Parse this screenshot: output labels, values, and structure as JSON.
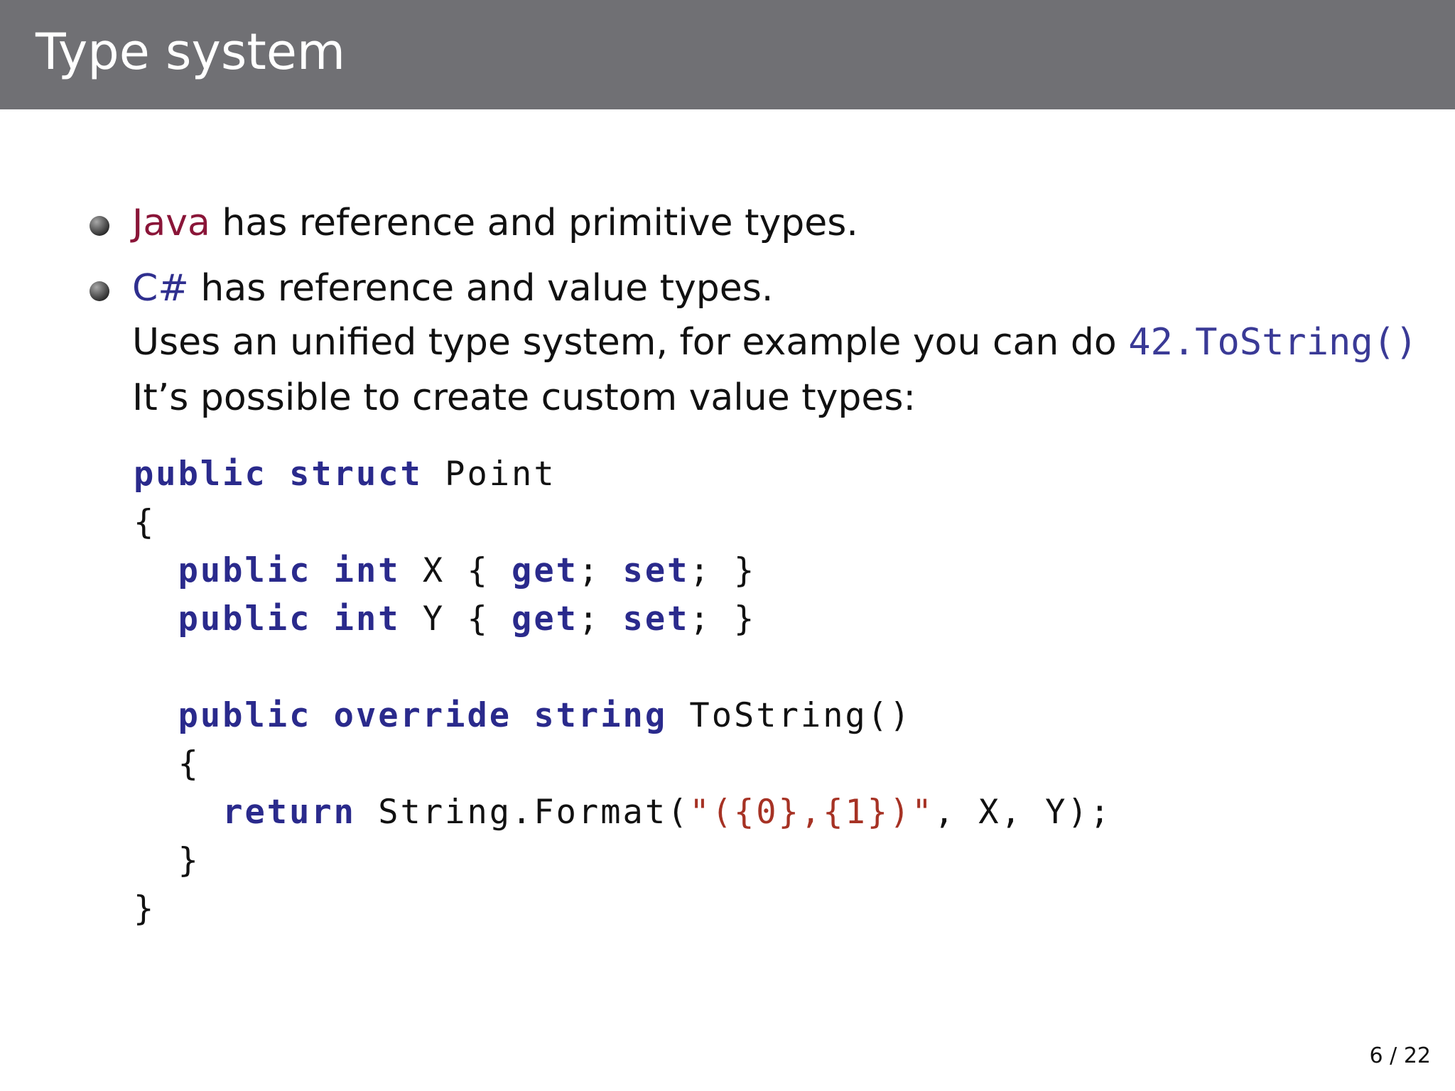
{
  "slide": {
    "title": "Type system",
    "bullets": [
      {
        "lead": "Java",
        "text": " has reference and primitive types."
      },
      {
        "lead": "C#",
        "text": " has reference and value types."
      }
    ],
    "continuation": {
      "line1_text": "Uses an unified type system, for example you can do ",
      "line1_code": "42.ToString()",
      "line2_text": "It’s possible to create custom value types:"
    },
    "code": {
      "line1_kw1": "public",
      "line1_kw2": "struct",
      "line1_name": "Point",
      "line2": "{",
      "line3_kw1": "public",
      "line3_kw2": "int",
      "line3_name": "X",
      "line3_brace_open": "{",
      "line3_get": "get",
      "line3_semicolon1": ";",
      "line3_set": "set",
      "line3_semicolon2": ";",
      "line3_brace_close": "}",
      "line4_kw1": "public",
      "line4_kw2": "int",
      "line4_name": "Y",
      "line4_brace_open": "{",
      "line4_get": "get",
      "line4_semicolon1": ";",
      "line4_set": "set",
      "line4_semicolon2": ";",
      "line4_brace_close": "}",
      "line6_kw1": "public",
      "line6_kw2": "override",
      "line6_kw3": "string",
      "line6_method": "ToString()",
      "line7": "{",
      "line8_kw": "return",
      "line8_call": "String.Format(",
      "line8_string": "\"({0},{1})\"",
      "line8_rest": ", X, Y);",
      "line9": "}",
      "line10": "}"
    },
    "page_number": "6 / 22"
  }
}
